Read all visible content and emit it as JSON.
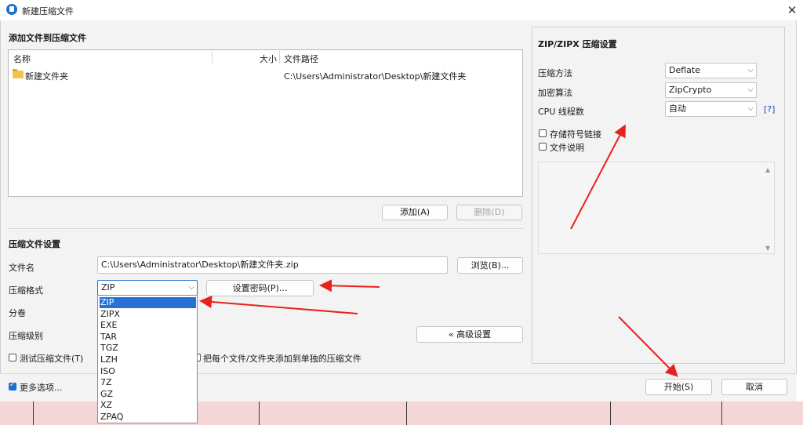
{
  "window": {
    "title": "新建压缩文件",
    "close_symbol": "✕"
  },
  "add_files": {
    "section_title": "添加文件到压缩文件",
    "columns": {
      "name": "名称",
      "size": "大小",
      "path": "文件路径"
    },
    "rows": [
      {
        "name": "新建文件夹",
        "size": "",
        "path": "C:\\Users\\Administrator\\Desktop\\新建文件夹"
      }
    ],
    "add_button": "添加(A)",
    "delete_button": "删除(D)"
  },
  "archive_settings": {
    "section_title": "压缩文件设置",
    "filename_label": "文件名",
    "filename_value": "C:\\Users\\Administrator\\Desktop\\新建文件夹.zip",
    "browse_button": "浏览(B)...",
    "format_label": "压缩格式",
    "format_value": "ZIP",
    "set_password_button": "设置密码(P)...",
    "split_label": "分卷",
    "level_label": "压缩级别",
    "advanced_button": "« 高级设置",
    "test_archive_label": "测试压缩文件(T)",
    "separate_archives_label": "把每个文件/文件夹添加到单独的压缩文件",
    "format_options": [
      "ZIP",
      "ZIPX",
      "EXE",
      "TAR",
      "TGZ",
      "LZH",
      "ISO",
      "7Z",
      "GZ",
      "XZ",
      "ZPAQ"
    ],
    "selected_option": "ZIP"
  },
  "zip_settings": {
    "section_title": "ZIP/ZIPX 压缩设置",
    "method_label": "压缩方法",
    "method_value": "Deflate",
    "encryption_label": "加密算法",
    "encryption_value": "ZipCrypto",
    "threads_label": "CPU 线程数",
    "threads_value": "自动",
    "help_link": "[?]",
    "store_symlinks_label": "存储符号链接",
    "file_comment_label": "文件说明",
    "scroll_up": "▲",
    "scroll_down": "▼"
  },
  "footer": {
    "more_options_label": "更多选项...",
    "more_options_checked": true,
    "start_button": "开始(S)",
    "cancel_button": "取消"
  },
  "colors": {
    "accent": "#1d6fd0",
    "selection": "#2670d6",
    "annotation_arrow": "#e8211d"
  },
  "icons": {
    "folder": "folder-icon",
    "app": "app-icon",
    "dropdown": "chevron-down-icon"
  }
}
